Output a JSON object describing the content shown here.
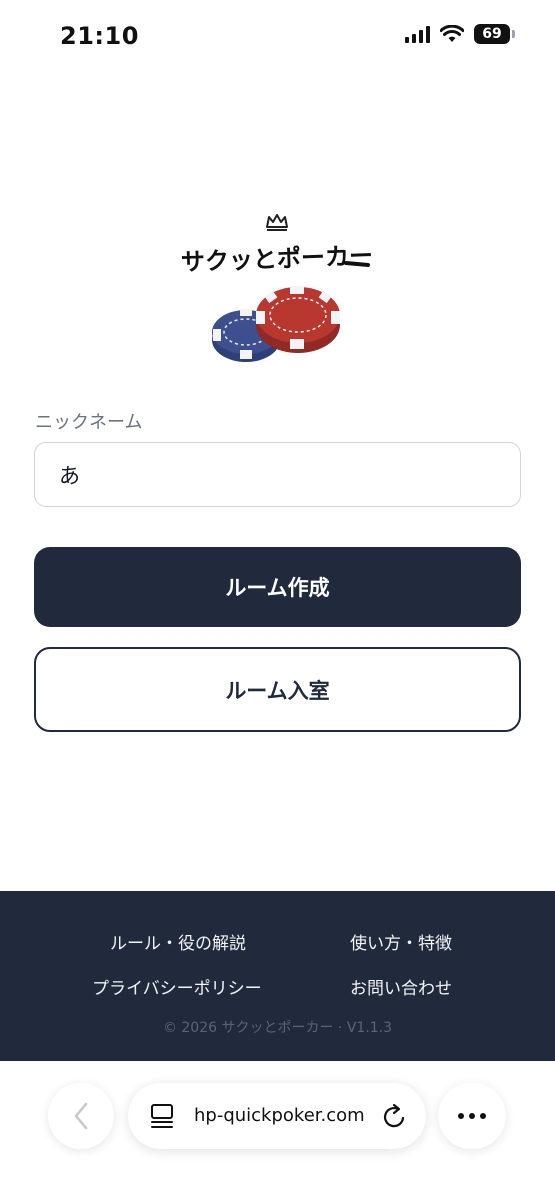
{
  "status_bar": {
    "time": "21:10",
    "battery": "69",
    "icons": [
      "cellular-signal-icon",
      "wifi-icon",
      "battery-icon"
    ]
  },
  "logo": {
    "text": "サクッとポーカー",
    "icons": [
      "crown-icon",
      "poker-chips-icon"
    ]
  },
  "form": {
    "nickname_label": "ニックネーム",
    "nickname_value": "あ",
    "create_room_button": "ルーム作成",
    "join_room_button": "ルーム入室"
  },
  "footer": {
    "links": {
      "rules": "ルール・役の解説",
      "how_to": "使い方・特徴",
      "privacy": "プライバシーポリシー",
      "contact": "お問い合わせ"
    },
    "copyright": "© 2026 サクッとポーカー · V1.1.3"
  },
  "browser": {
    "url": "hp-quickpoker.com",
    "icons": [
      "back-arrow-icon",
      "tabs-icon",
      "reload-icon",
      "more-icon"
    ]
  },
  "colors": {
    "primary": "#212a3c",
    "background": "#ffffff",
    "chip_red": "#b8372f",
    "chip_blue": "#3d4f8f"
  }
}
